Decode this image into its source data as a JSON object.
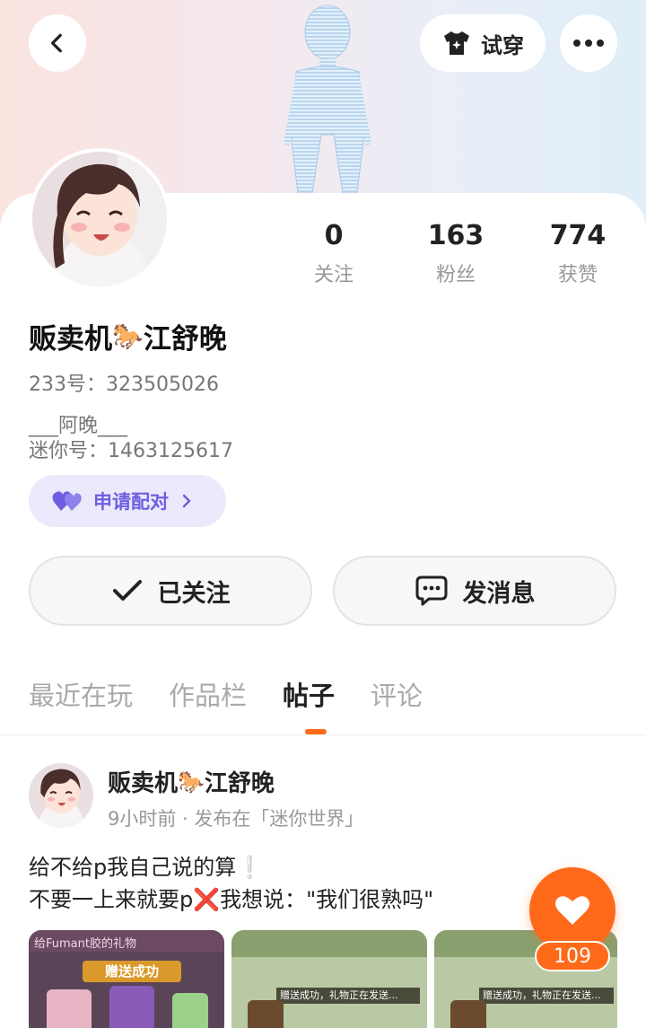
{
  "header": {
    "tryon_label": "试穿"
  },
  "stats": [
    {
      "num": "0",
      "label": "关注"
    },
    {
      "num": "163",
      "label": "粉丝"
    },
    {
      "num": "774",
      "label": "获赞"
    }
  ],
  "profile": {
    "name_part1": "贩卖机",
    "name_emoji": "🐎",
    "name_part2": "江舒晚",
    "id_233": "233号：323505026",
    "bio": "___阿晚___",
    "mini_id": "迷你号：1463125617",
    "pair_label": "申请配对"
  },
  "actions": {
    "followed_label": "已关注",
    "message_label": "发消息"
  },
  "tabs": [
    "最近在玩",
    "作品栏",
    "帖子",
    "评论"
  ],
  "post": {
    "author_part1": "贩卖机",
    "author_emoji": "🐎",
    "author_part2": "江舒晚",
    "time": "9小时前 · 发布在「迷你世界」",
    "line1": "给不给p我自己说的算",
    "line1_emoji": "❕",
    "line2a": "不要一上来就要p",
    "line2_emoji": "❌",
    "line2b": "我想说：\"我们很熟吗\"",
    "thumb1_caption": "赠送成功",
    "thumb1_top": "给Fumant胶的礼物",
    "thumb2_caption": "赠送成功，礼物正在发送...",
    "thumb3_caption": "赠送成功，礼物正在发送...",
    "likes": "109"
  },
  "colors": {
    "accent": "#ff6a1a",
    "pair_purple": "#6d5fe0"
  }
}
